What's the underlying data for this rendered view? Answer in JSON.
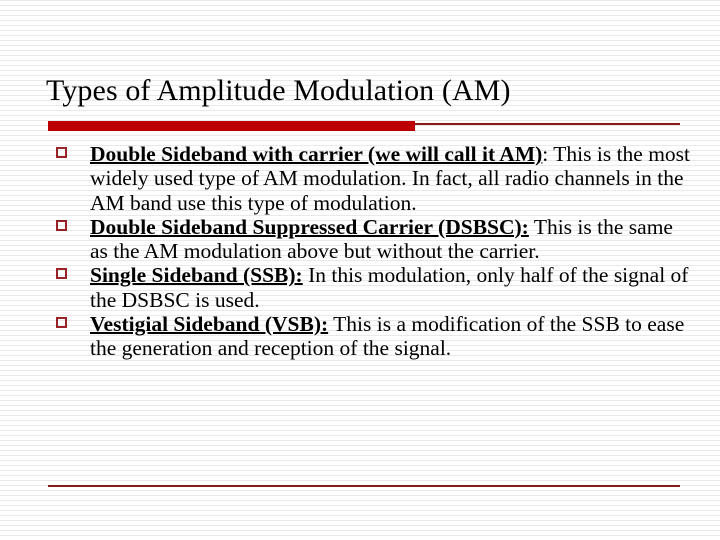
{
  "slide": {
    "title": "Types of Amplitude Modulation (AM)",
    "colors": {
      "title_text": "#000000",
      "body_text": "#000000",
      "rule_thick_red": "#C00000",
      "rule_thin_maroon": "#8B1A1A",
      "bullet_marker": "#9B2226",
      "background": "#FFFFFF"
    },
    "bullet_icon": "hollow-square-bullet",
    "bullets": [
      {
        "lead": "Double Sideband with carrier (we will call it AM)",
        "lead_tail": ":",
        "rest": " This is the most widely used type of AM modulation. In fact, all radio channels in the AM band use this type of modulation."
      },
      {
        "lead": "Double Sideband Suppressed Carrier (DSBSC):",
        "lead_tail": "",
        "rest": " This is the same as the AM modulation above but without the carrier."
      },
      {
        "lead": "Single Sideband (SSB):",
        "lead_tail": "",
        "rest": " In this modulation, only half of the signal of the DSBSC is used."
      },
      {
        "lead": "Vestigial Sideband (VSB):",
        "lead_tail": "",
        "rest": " This is a modification of the SSB to ease the generation and reception of the signal."
      }
    ]
  }
}
